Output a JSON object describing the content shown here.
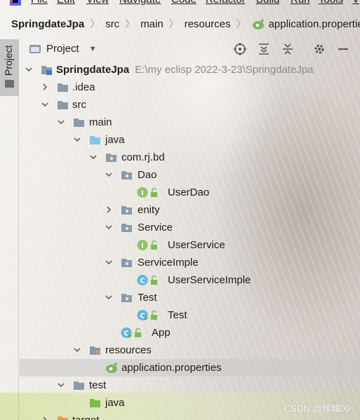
{
  "menu": [
    {
      "label": "File"
    },
    {
      "label": "Edit"
    },
    {
      "label": "View"
    },
    {
      "label": "Navigate"
    },
    {
      "label": "Code"
    },
    {
      "label": "Refactor"
    },
    {
      "label": "Build"
    },
    {
      "label": "Run"
    },
    {
      "label": "Tools"
    },
    {
      "label": "V"
    }
  ],
  "breadcrumb": [
    "SpringdateJpa",
    "src",
    "main",
    "resources",
    "application.properties"
  ],
  "side_tab": {
    "label": "Project"
  },
  "panel": {
    "title": "Project"
  },
  "tree": [
    {
      "label": "SpringdateJpa",
      "path": "E:\\my eclisp 2022-3-23\\SpringdateJpa",
      "icon": "module-folder-icon"
    },
    {
      "label": ".idea",
      "icon": "folder-icon"
    },
    {
      "label": "src",
      "icon": "folder-icon"
    },
    {
      "label": "main",
      "icon": "folder-icon"
    },
    {
      "label": "java",
      "icon": "source-folder-icon"
    },
    {
      "label": "com.rj.bd",
      "icon": "package-icon"
    },
    {
      "label": "Dao",
      "icon": "package-icon"
    },
    {
      "label": "UserDao",
      "icon": "interface-icon"
    },
    {
      "label": "enity",
      "icon": "package-icon"
    },
    {
      "label": "Service",
      "icon": "package-icon"
    },
    {
      "label": "UserService",
      "icon": "interface-icon"
    },
    {
      "label": "ServiceImple",
      "icon": "package-icon"
    },
    {
      "label": "UserServiceImple",
      "icon": "class-icon"
    },
    {
      "label": "Test",
      "icon": "package-icon"
    },
    {
      "label": "Test",
      "icon": "runnable-class-icon"
    },
    {
      "label": "App",
      "icon": "runnable-class-icon"
    },
    {
      "label": "resources",
      "icon": "resources-folder-icon"
    },
    {
      "label": "application.properties",
      "icon": "spring-properties-icon"
    },
    {
      "label": "test",
      "icon": "folder-icon"
    },
    {
      "label": "java",
      "icon": "test-source-folder-icon"
    },
    {
      "label": "target",
      "icon": "excluded-folder-icon"
    }
  ],
  "watermark": "CSDN @倾城00",
  "colors": {
    "folder": "#8c9aa8",
    "source_folder": "#87c5e8",
    "test_source_folder": "#7dbb4e",
    "interface": "#8fc16d",
    "class": "#5fb7d8",
    "resources_stripe": "#e3a23a",
    "excluded_folder": "#e49a5a"
  }
}
